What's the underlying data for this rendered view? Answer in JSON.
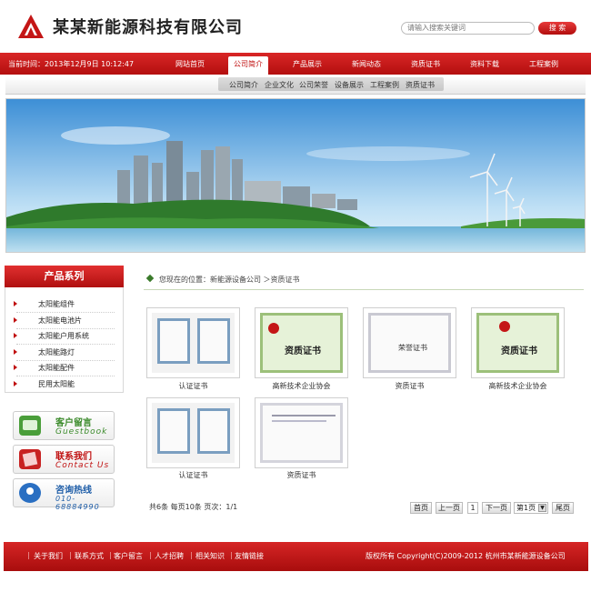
{
  "header": {
    "company_name": "某某新能源科技有限公司",
    "search_placeholder": "请输入搜索关键词",
    "search_button": "搜 索"
  },
  "nav": {
    "datetime": "当前时间：2013年12月9日 10:12:47",
    "items": [
      "网站首页",
      "公司简介",
      "产品展示",
      "新闻动态",
      "资质证书",
      "资料下载",
      "工程案例"
    ],
    "active": "公司简介"
  },
  "subnav": {
    "items": [
      "公司简介",
      "企业文化",
      "公司荣誉",
      "设备展示",
      "工程案例",
      "资质证书"
    ]
  },
  "sidebar": {
    "title": "产品系列",
    "items": [
      "太阳能组件",
      "太阳能电池片",
      "太阳能户用系统",
      "太阳能路灯",
      "太阳能配件",
      "民用太阳能"
    ],
    "contact": [
      {
        "title": "客户留言",
        "subtitle": "Guestbook"
      },
      {
        "title": "联系我们",
        "subtitle": "Contact Us"
      },
      {
        "title": "咨询热线",
        "subtitle": "010-68884990"
      }
    ]
  },
  "breadcrumb": {
    "text": "您现在的位置：新能源设备公司 ＞资质证书"
  },
  "certificates": [
    {
      "caption": "认证证书"
    },
    {
      "caption": "高新技术企业协会"
    },
    {
      "caption": "资质证书"
    },
    {
      "caption": "高新技术企业协会"
    },
    {
      "caption": "认证证书"
    },
    {
      "caption": "资质证书"
    }
  ],
  "cert_texts": {
    "qualification": "资质证书",
    "honor": "荣誉证书"
  },
  "pagination": {
    "info": "共6条 每页10条 页次：1/1",
    "first": "首页",
    "prev": "上一页",
    "current": "1",
    "next": "下一页",
    "select": "第1页",
    "last": "尾页"
  },
  "footer": {
    "links": [
      "关于我们",
      "联系方式",
      "客户留言",
      "人才招聘",
      "相关知识",
      "友情链接"
    ],
    "copyright": "版权所有 Copyright(C)2009-2012 杭州市某新能源设备公司"
  },
  "colors": {
    "brand_red": "#c01010",
    "accent_green": "#3a7a2a"
  }
}
